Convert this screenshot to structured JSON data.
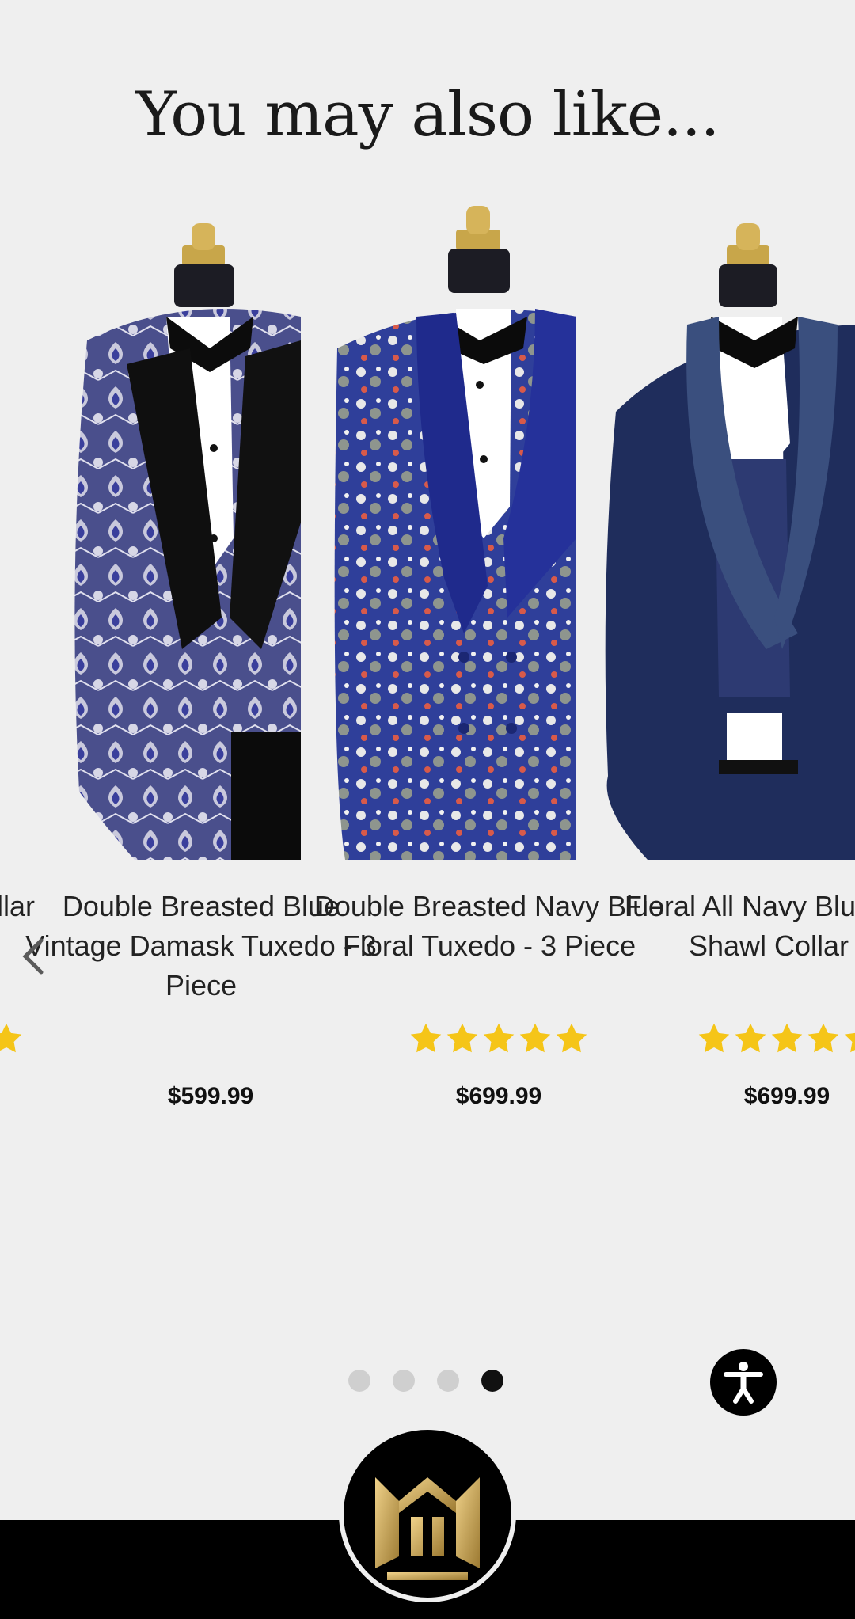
{
  "section": {
    "title": "You may also like..."
  },
  "products": [
    {
      "partial_title": "n Collar\ne"
    },
    {
      "title": "Double Breasted Blue Vintage Damask Tuxedo - 3 Piece",
      "price": "$599.99",
      "rating": null
    },
    {
      "title": "Double Breasted Navy Blue Floral Tuxedo - 3 Piece",
      "price": "$699.99",
      "rating": 5
    },
    {
      "title": "Floral All Navy Blue with Shawl Collar -",
      "price": "$699.99",
      "rating": 5
    }
  ],
  "carousel": {
    "dot_count": 4,
    "active_dot": 4
  },
  "colors": {
    "background": "#efefef",
    "star": "#f5c518",
    "accent_gold": "#c8a64a",
    "footer": "#000000"
  },
  "icons": {
    "prev": "chevron-left-icon",
    "accessibility": "accessibility-icon",
    "logo": "brand-logo"
  }
}
